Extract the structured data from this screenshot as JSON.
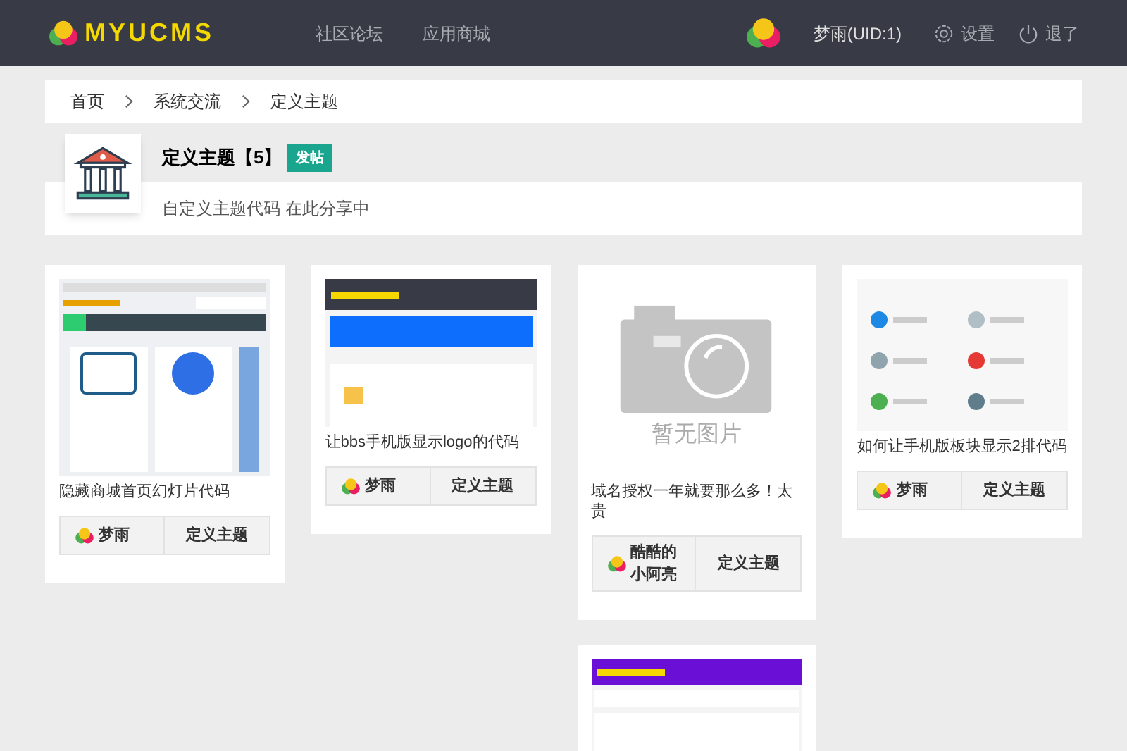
{
  "header": {
    "logo": "MYUCMS",
    "nav": [
      {
        "label": "社区论坛"
      },
      {
        "label": "应用商城"
      }
    ],
    "user": "梦雨(UID:1)",
    "settings": "设置",
    "logout": "退了"
  },
  "breadcrumb": [
    "首页",
    "系统交流",
    "定义主题"
  ],
  "forum": {
    "title": "定义主题【**5**】",
    "post_button": "发帖",
    "description": "自定义主题代码 在此分享中"
  },
  "posts": [
    {
      "thumbnail": {
        "kind": "slideshow"
      },
      "title": "隐藏商城首页幻灯片代码",
      "author": "梦雨",
      "category": "定义主题"
    },
    {
      "thumbnail": {
        "kind": "mobile"
      },
      "title": "让bbs手机版显示logo的代码",
      "author": "梦雨",
      "category": "定义主题"
    },
    {
      "thumbnail": {
        "kind": "none",
        "text": "暂无图片"
      },
      "title": "域名授权一年就要那么多！太贵",
      "author": "酷酷的小阿亮",
      "category": "定义主题"
    },
    {
      "thumbnail": {
        "kind": "grid"
      },
      "title": "如何让手机版板块显示2排代码",
      "author": "梦雨",
      "category": "定义主题"
    },
    {
      "thumbnail": {
        "kind": "purple"
      }
    }
  ]
}
